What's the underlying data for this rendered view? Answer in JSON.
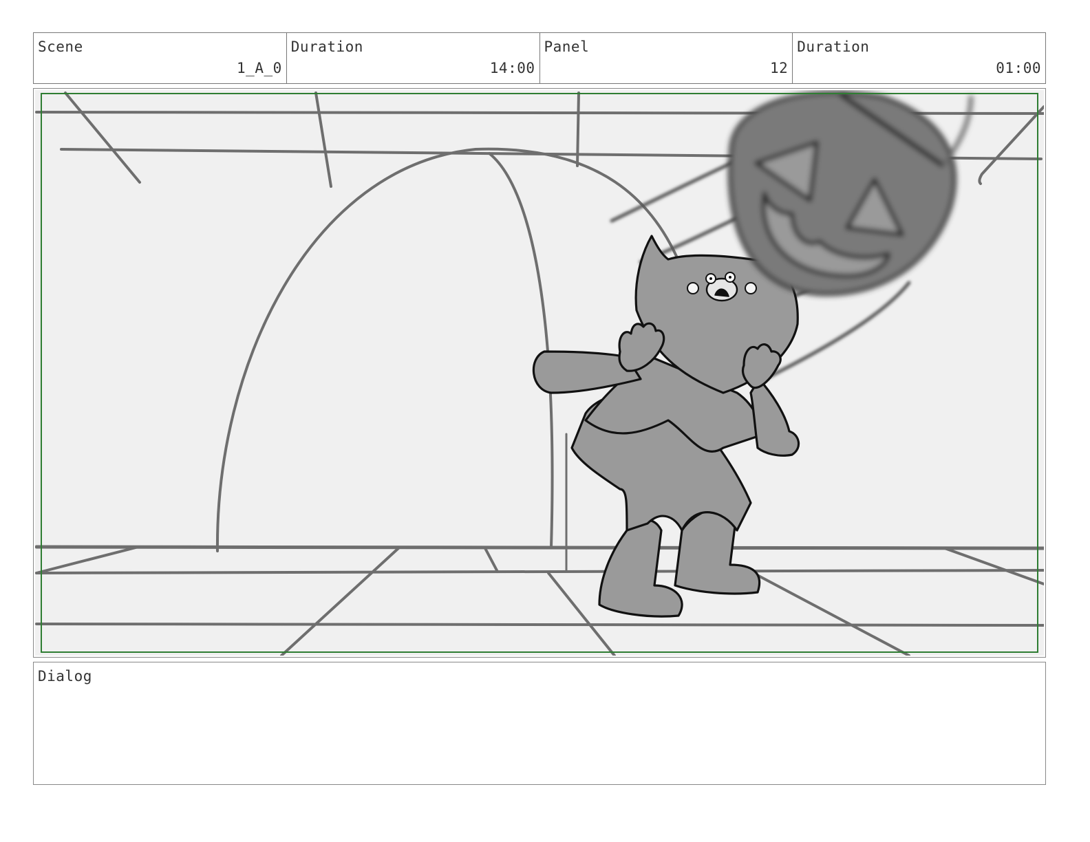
{
  "header": {
    "scene_label": "Scene",
    "scene_value": "1_A_0",
    "scene_duration_label": "Duration",
    "scene_duration_value": "14:00",
    "panel_label": "Panel",
    "panel_value": "12",
    "panel_duration_label": "Duration",
    "panel_duration_value": "01:00"
  },
  "dialog": {
    "label": "Dialog",
    "text": ""
  },
  "colors": {
    "safe_frame": "#2e7d32",
    "background": "#f0f0f0",
    "character_fill": "#9a9a9a",
    "ball_fill": "#7a7a7a"
  }
}
